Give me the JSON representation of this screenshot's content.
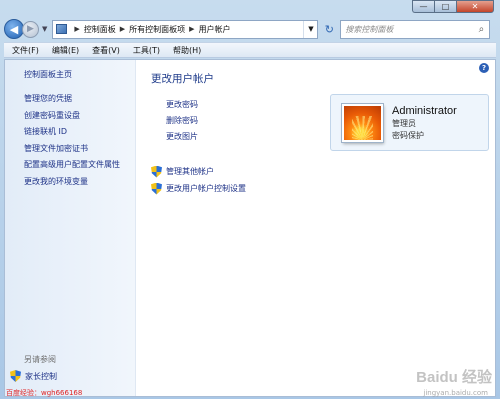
{
  "window": {
    "minimize_glyph": "—",
    "maximize_glyph": "□",
    "close_glyph": "✕"
  },
  "address": {
    "crumbs": [
      "控制面板",
      "所有控制面板项",
      "用户帐户"
    ],
    "search_placeholder": "搜索控制面板"
  },
  "menu": {
    "items": [
      "文件(F)",
      "编辑(E)",
      "查看(V)",
      "工具(T)",
      "帮助(H)"
    ]
  },
  "sidebar": {
    "home": "控制面板主页",
    "tasks": [
      "管理您的凭据",
      "创建密码重设盘",
      "链接联机 ID",
      "管理文件加密证书",
      "配置高级用户配置文件属性",
      "更改我的环境变量"
    ],
    "see_also": "另请参阅",
    "parental_controls": "家长控制"
  },
  "main": {
    "title": "更改用户帐户",
    "links": [
      "更改密码",
      "删除密码",
      "更改图片"
    ],
    "shield_links": [
      "管理其他帐户",
      "更改用户帐户控制设置"
    ]
  },
  "account": {
    "name": "Administrator",
    "role": "管理员",
    "status": "密码保护"
  },
  "watermark": {
    "red_text": "百度经验：wgh666168",
    "logo": "Baidu 经验",
    "url": "jingyan.baidu.com"
  },
  "colors": {
    "link": "#1e3287",
    "title": "#1e3b8a",
    "accent": "#2c5fb5"
  },
  "icons": {
    "back": "back-arrow-icon",
    "forward": "forward-arrow-icon",
    "refresh": "refresh-icon",
    "search": "search-icon",
    "help": "help-icon",
    "shield": "uac-shield-icon"
  }
}
